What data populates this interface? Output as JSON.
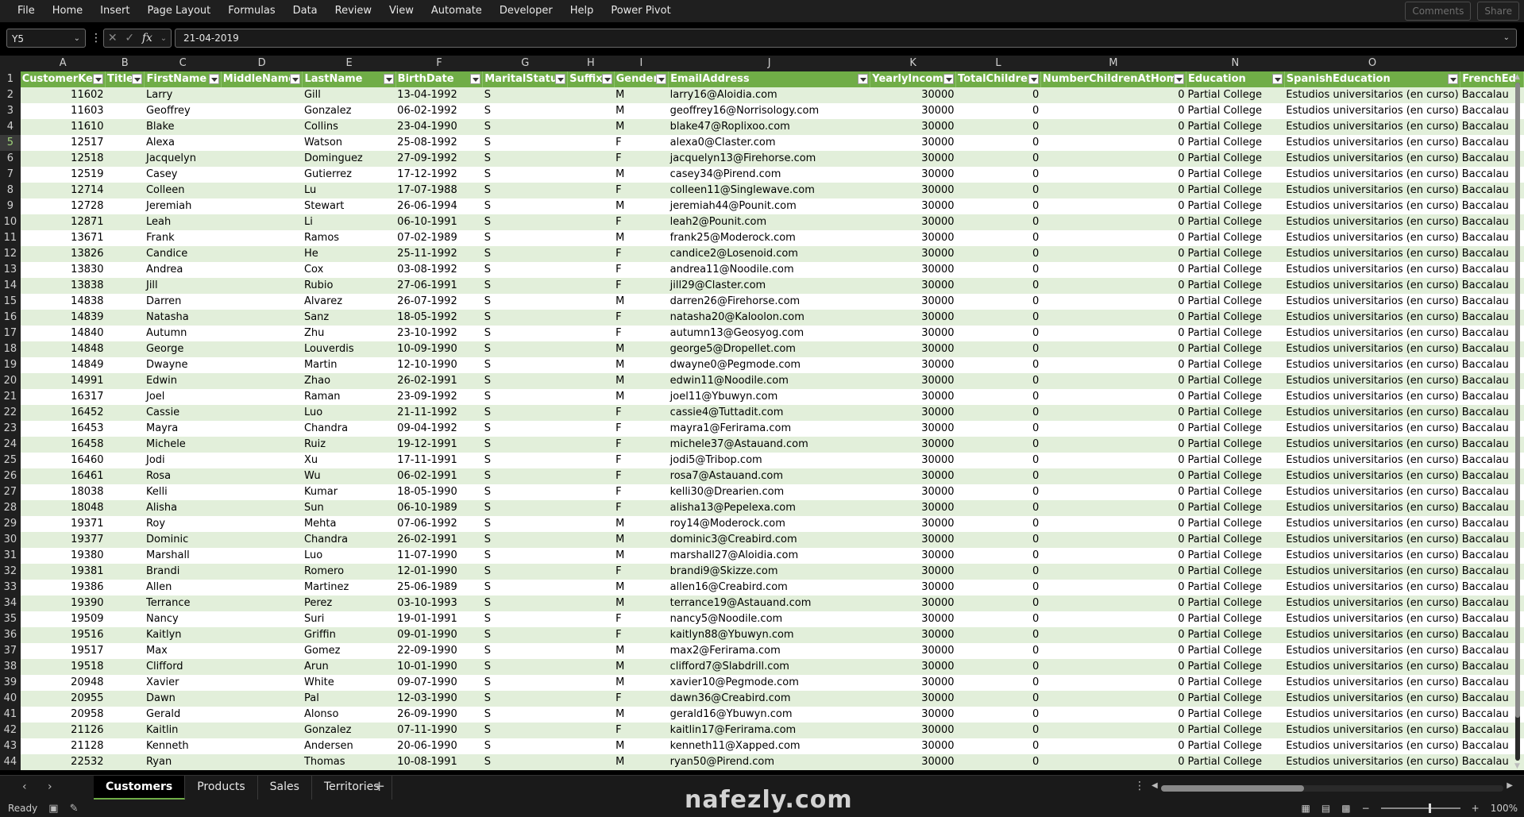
{
  "menu": [
    "File",
    "Home",
    "Insert",
    "Page Layout",
    "Formulas",
    "Data",
    "Review",
    "View",
    "Automate",
    "Developer",
    "Help",
    "Power Pivot"
  ],
  "menu_right": {
    "comments": "Comments",
    "share": "Share"
  },
  "formula_bar": {
    "name_box": "Y5",
    "value": "21-04-2019",
    "fx": "fx"
  },
  "columns": [
    "A",
    "B",
    "C",
    "D",
    "E",
    "F",
    "G",
    "H",
    "I",
    "J",
    "K",
    "L",
    "M",
    "N",
    "O",
    ""
  ],
  "headers": [
    "CustomerKey",
    "Title",
    "FirstName",
    "MiddleName",
    "LastName",
    "BirthDate",
    "MaritalStatus",
    "Suffix",
    "Gender",
    "EmailAddress",
    "YearlyIncome",
    "TotalChildren",
    "NumberChildrenAtHome",
    "Education",
    "SpanishEducation",
    "FrenchEd"
  ],
  "selected_row": 5,
  "rows": [
    [
      "11602",
      "",
      "Larry",
      "",
      "Gill",
      "13-04-1992",
      "S",
      "",
      "M",
      "larry16@Aloidia.com",
      "30000",
      "0",
      "0",
      "Partial College",
      "Estudios universitarios (en curso)",
      "Baccalau"
    ],
    [
      "11603",
      "",
      "Geoffrey",
      "",
      "Gonzalez",
      "06-02-1992",
      "S",
      "",
      "M",
      "geoffrey16@Norrisology.com",
      "30000",
      "0",
      "0",
      "Partial College",
      "Estudios universitarios (en curso)",
      "Baccalau"
    ],
    [
      "11610",
      "",
      "Blake",
      "",
      "Collins",
      "23-04-1990",
      "S",
      "",
      "M",
      "blake47@Roplixoo.com",
      "30000",
      "0",
      "0",
      "Partial College",
      "Estudios universitarios (en curso)",
      "Baccalau"
    ],
    [
      "12517",
      "",
      "Alexa",
      "",
      "Watson",
      "25-08-1992",
      "S",
      "",
      "F",
      "alexa0@Claster.com",
      "30000",
      "0",
      "0",
      "Partial College",
      "Estudios universitarios (en curso)",
      "Baccalau"
    ],
    [
      "12518",
      "",
      "Jacquelyn",
      "",
      "Dominguez",
      "27-09-1992",
      "S",
      "",
      "F",
      "jacquelyn13@Firehorse.com",
      "30000",
      "0",
      "0",
      "Partial College",
      "Estudios universitarios (en curso)",
      "Baccalau"
    ],
    [
      "12519",
      "",
      "Casey",
      "",
      "Gutierrez",
      "17-12-1992",
      "S",
      "",
      "M",
      "casey34@Pirend.com",
      "30000",
      "0",
      "0",
      "Partial College",
      "Estudios universitarios (en curso)",
      "Baccalau"
    ],
    [
      "12714",
      "",
      "Colleen",
      "",
      "Lu",
      "17-07-1988",
      "S",
      "",
      "F",
      "colleen11@Singlewave.com",
      "30000",
      "0",
      "0",
      "Partial College",
      "Estudios universitarios (en curso)",
      "Baccalau"
    ],
    [
      "12728",
      "",
      "Jeremiah",
      "",
      "Stewart",
      "26-06-1994",
      "S",
      "",
      "M",
      "jeremiah44@Pounit.com",
      "30000",
      "0",
      "0",
      "Partial College",
      "Estudios universitarios (en curso)",
      "Baccalau"
    ],
    [
      "12871",
      "",
      "Leah",
      "",
      "Li",
      "06-10-1991",
      "S",
      "",
      "F",
      "leah2@Pounit.com",
      "30000",
      "0",
      "0",
      "Partial College",
      "Estudios universitarios (en curso)",
      "Baccalau"
    ],
    [
      "13671",
      "",
      "Frank",
      "",
      "Ramos",
      "07-02-1989",
      "S",
      "",
      "M",
      "frank25@Moderock.com",
      "30000",
      "0",
      "0",
      "Partial College",
      "Estudios universitarios (en curso)",
      "Baccalau"
    ],
    [
      "13826",
      "",
      "Candice",
      "",
      "He",
      "25-11-1992",
      "S",
      "",
      "F",
      "candice2@Losenoid.com",
      "30000",
      "0",
      "0",
      "Partial College",
      "Estudios universitarios (en curso)",
      "Baccalau"
    ],
    [
      "13830",
      "",
      "Andrea",
      "",
      "Cox",
      "03-08-1992",
      "S",
      "",
      "F",
      "andrea11@Noodile.com",
      "30000",
      "0",
      "0",
      "Partial College",
      "Estudios universitarios (en curso)",
      "Baccalau"
    ],
    [
      "13838",
      "",
      "Jill",
      "",
      "Rubio",
      "27-06-1991",
      "S",
      "",
      "F",
      "jill29@Claster.com",
      "30000",
      "0",
      "0",
      "Partial College",
      "Estudios universitarios (en curso)",
      "Baccalau"
    ],
    [
      "14838",
      "",
      "Darren",
      "",
      "Alvarez",
      "26-07-1992",
      "S",
      "",
      "M",
      "darren26@Firehorse.com",
      "30000",
      "0",
      "0",
      "Partial College",
      "Estudios universitarios (en curso)",
      "Baccalau"
    ],
    [
      "14839",
      "",
      "Natasha",
      "",
      "Sanz",
      "18-05-1992",
      "S",
      "",
      "F",
      "natasha20@Kaloolon.com",
      "30000",
      "0",
      "0",
      "Partial College",
      "Estudios universitarios (en curso)",
      "Baccalau"
    ],
    [
      "14840",
      "",
      "Autumn",
      "",
      "Zhu",
      "23-10-1992",
      "S",
      "",
      "F",
      "autumn13@Geosyog.com",
      "30000",
      "0",
      "0",
      "Partial College",
      "Estudios universitarios (en curso)",
      "Baccalau"
    ],
    [
      "14848",
      "",
      "George",
      "",
      "Louverdis",
      "10-09-1990",
      "S",
      "",
      "M",
      "george5@Dropellet.com",
      "30000",
      "0",
      "0",
      "Partial College",
      "Estudios universitarios (en curso)",
      "Baccalau"
    ],
    [
      "14849",
      "",
      "Dwayne",
      "",
      "Martin",
      "12-10-1990",
      "S",
      "",
      "M",
      "dwayne0@Pegmode.com",
      "30000",
      "0",
      "0",
      "Partial College",
      "Estudios universitarios (en curso)",
      "Baccalau"
    ],
    [
      "14991",
      "",
      "Edwin",
      "",
      "Zhao",
      "26-02-1991",
      "S",
      "",
      "M",
      "edwin11@Noodile.com",
      "30000",
      "0",
      "0",
      "Partial College",
      "Estudios universitarios (en curso)",
      "Baccalau"
    ],
    [
      "16317",
      "",
      "Joel",
      "",
      "Raman",
      "23-09-1992",
      "S",
      "",
      "M",
      "joel11@Ybuwyn.com",
      "30000",
      "0",
      "0",
      "Partial College",
      "Estudios universitarios (en curso)",
      "Baccalau"
    ],
    [
      "16452",
      "",
      "Cassie",
      "",
      "Luo",
      "21-11-1992",
      "S",
      "",
      "F",
      "cassie4@Tuttadit.com",
      "30000",
      "0",
      "0",
      "Partial College",
      "Estudios universitarios (en curso)",
      "Baccalau"
    ],
    [
      "16453",
      "",
      "Mayra",
      "",
      "Chandra",
      "09-04-1992",
      "S",
      "",
      "F",
      "mayra1@Ferirama.com",
      "30000",
      "0",
      "0",
      "Partial College",
      "Estudios universitarios (en curso)",
      "Baccalau"
    ],
    [
      "16458",
      "",
      "Michele",
      "",
      "Ruiz",
      "19-12-1991",
      "S",
      "",
      "F",
      "michele37@Astauand.com",
      "30000",
      "0",
      "0",
      "Partial College",
      "Estudios universitarios (en curso)",
      "Baccalau"
    ],
    [
      "16460",
      "",
      "Jodi",
      "",
      "Xu",
      "17-11-1991",
      "S",
      "",
      "F",
      "jodi5@Tribop.com",
      "30000",
      "0",
      "0",
      "Partial College",
      "Estudios universitarios (en curso)",
      "Baccalau"
    ],
    [
      "16461",
      "",
      "Rosa",
      "",
      "Wu",
      "06-02-1991",
      "S",
      "",
      "F",
      "rosa7@Astauand.com",
      "30000",
      "0",
      "0",
      "Partial College",
      "Estudios universitarios (en curso)",
      "Baccalau"
    ],
    [
      "18038",
      "",
      "Kelli",
      "",
      "Kumar",
      "18-05-1990",
      "S",
      "",
      "F",
      "kelli30@Drearien.com",
      "30000",
      "0",
      "0",
      "Partial College",
      "Estudios universitarios (en curso)",
      "Baccalau"
    ],
    [
      "18048",
      "",
      "Alisha",
      "",
      "Sun",
      "06-10-1989",
      "S",
      "",
      "F",
      "alisha13@Pepelexa.com",
      "30000",
      "0",
      "0",
      "Partial College",
      "Estudios universitarios (en curso)",
      "Baccalau"
    ],
    [
      "19371",
      "",
      "Roy",
      "",
      "Mehta",
      "07-06-1992",
      "S",
      "",
      "M",
      "roy14@Moderock.com",
      "30000",
      "0",
      "0",
      "Partial College",
      "Estudios universitarios (en curso)",
      "Baccalau"
    ],
    [
      "19377",
      "",
      "Dominic",
      "",
      "Chandra",
      "26-02-1991",
      "S",
      "",
      "M",
      "dominic3@Creabird.com",
      "30000",
      "0",
      "0",
      "Partial College",
      "Estudios universitarios (en curso)",
      "Baccalau"
    ],
    [
      "19380",
      "",
      "Marshall",
      "",
      "Luo",
      "11-07-1990",
      "S",
      "",
      "M",
      "marshall27@Aloidia.com",
      "30000",
      "0",
      "0",
      "Partial College",
      "Estudios universitarios (en curso)",
      "Baccalau"
    ],
    [
      "19381",
      "",
      "Brandi",
      "",
      "Romero",
      "12-01-1990",
      "S",
      "",
      "F",
      "brandi9@Skizze.com",
      "30000",
      "0",
      "0",
      "Partial College",
      "Estudios universitarios (en curso)",
      "Baccalau"
    ],
    [
      "19386",
      "",
      "Allen",
      "",
      "Martinez",
      "25-06-1989",
      "S",
      "",
      "M",
      "allen16@Creabird.com",
      "30000",
      "0",
      "0",
      "Partial College",
      "Estudios universitarios (en curso)",
      "Baccalau"
    ],
    [
      "19390",
      "",
      "Terrance",
      "",
      "Perez",
      "03-10-1993",
      "S",
      "",
      "M",
      "terrance19@Astauand.com",
      "30000",
      "0",
      "0",
      "Partial College",
      "Estudios universitarios (en curso)",
      "Baccalau"
    ],
    [
      "19509",
      "",
      "Nancy",
      "",
      "Suri",
      "19-01-1991",
      "S",
      "",
      "F",
      "nancy5@Noodile.com",
      "30000",
      "0",
      "0",
      "Partial College",
      "Estudios universitarios (en curso)",
      "Baccalau"
    ],
    [
      "19516",
      "",
      "Kaitlyn",
      "",
      "Griffin",
      "09-01-1990",
      "S",
      "",
      "F",
      "kaitlyn88@Ybuwyn.com",
      "30000",
      "0",
      "0",
      "Partial College",
      "Estudios universitarios (en curso)",
      "Baccalau"
    ],
    [
      "19517",
      "",
      "Max",
      "",
      "Gomez",
      "22-09-1990",
      "S",
      "",
      "M",
      "max2@Ferirama.com",
      "30000",
      "0",
      "0",
      "Partial College",
      "Estudios universitarios (en curso)",
      "Baccalau"
    ],
    [
      "19518",
      "",
      "Clifford",
      "",
      "Arun",
      "10-01-1990",
      "S",
      "",
      "M",
      "clifford7@Slabdrill.com",
      "30000",
      "0",
      "0",
      "Partial College",
      "Estudios universitarios (en curso)",
      "Baccalau"
    ],
    [
      "20948",
      "",
      "Xavier",
      "",
      "White",
      "09-07-1990",
      "S",
      "",
      "M",
      "xavier10@Pegmode.com",
      "30000",
      "0",
      "0",
      "Partial College",
      "Estudios universitarios (en curso)",
      "Baccalau"
    ],
    [
      "20955",
      "",
      "Dawn",
      "",
      "Pal",
      "12-03-1990",
      "S",
      "",
      "F",
      "dawn36@Creabird.com",
      "30000",
      "0",
      "0",
      "Partial College",
      "Estudios universitarios (en curso)",
      "Baccalau"
    ],
    [
      "20958",
      "",
      "Gerald",
      "",
      "Alonso",
      "26-09-1990",
      "S",
      "",
      "M",
      "gerald16@Ybuwyn.com",
      "30000",
      "0",
      "0",
      "Partial College",
      "Estudios universitarios (en curso)",
      "Baccalau"
    ],
    [
      "21126",
      "",
      "Kaitlin",
      "",
      "Gonzalez",
      "07-11-1990",
      "S",
      "",
      "F",
      "kaitlin17@Ferirama.com",
      "30000",
      "0",
      "0",
      "Partial College",
      "Estudios universitarios (en curso)",
      "Baccalau"
    ],
    [
      "21128",
      "",
      "Kenneth",
      "",
      "Andersen",
      "20-06-1990",
      "S",
      "",
      "M",
      "kenneth11@Xapped.com",
      "30000",
      "0",
      "0",
      "Partial College",
      "Estudios universitarios (en curso)",
      "Baccalau"
    ],
    [
      "22532",
      "",
      "Ryan",
      "",
      "Thomas",
      "10-08-1991",
      "S",
      "",
      "M",
      "ryan50@Pirend.com",
      "30000",
      "0",
      "0",
      "Partial College",
      "Estudios universitarios (en curso)",
      "Baccalau"
    ]
  ],
  "sheet_tabs": [
    "Customers",
    "Products",
    "Sales",
    "Territories"
  ],
  "active_tab": "Customers",
  "status": {
    "ready": "Ready",
    "zoom": "100%"
  },
  "watermark": "nafezly.com",
  "colors": {
    "header_green": "#70ad47",
    "band_light": "#e2efda"
  }
}
